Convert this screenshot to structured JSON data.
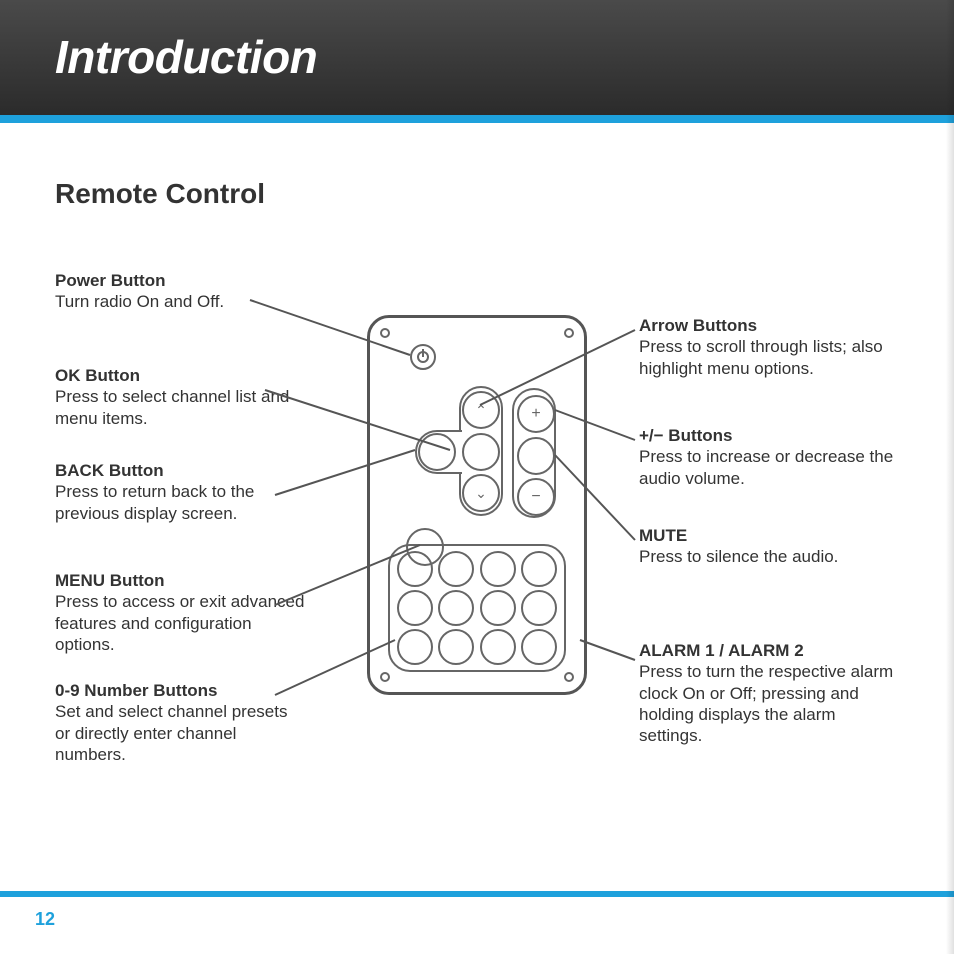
{
  "header": {
    "title": "Introduction"
  },
  "section": {
    "title": "Remote Control"
  },
  "labels": {
    "power": {
      "title": "Power Button",
      "desc": "Turn radio On and Off."
    },
    "ok": {
      "title": "OK Button",
      "desc": "Press to select channel list and menu items."
    },
    "back": {
      "title": "BACK Button",
      "desc": "Press to return back to the previous display screen."
    },
    "menu": {
      "title": "MENU Button",
      "desc": "Press to access or exit advanced features and configuration options."
    },
    "numbers": {
      "title": "0-9 Number Buttons",
      "desc": "Set and select channel presets or directly enter channel numbers."
    },
    "arrow": {
      "title": "Arrow Buttons",
      "desc": "Press to scroll through lists; also highlight menu options."
    },
    "plusminus": {
      "title": "+/− Buttons",
      "desc": "Press to increase or decrease the audio volume."
    },
    "mute": {
      "title": "MUTE",
      "desc": "Press to silence the audio."
    },
    "alarm": {
      "title": "ALARM 1 / ALARM 2",
      "desc": "Press to turn the respective alarm clock On or Off; pressing and holding displays the alarm settings."
    }
  },
  "page_number": "12",
  "glyphs": {
    "up": "⌃",
    "down": "⌄",
    "plus": "+",
    "minus": "−"
  }
}
